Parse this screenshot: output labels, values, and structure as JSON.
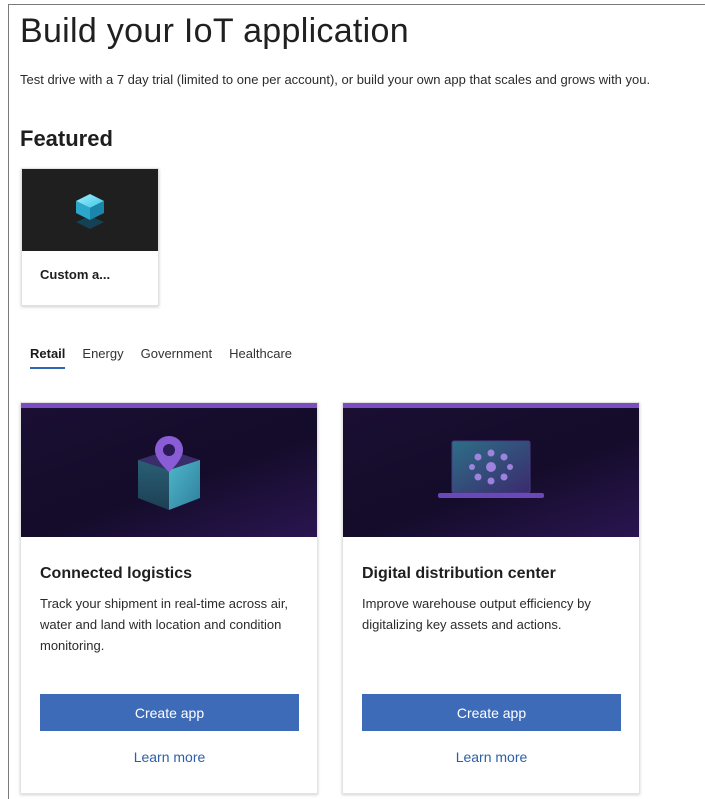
{
  "page": {
    "title": "Build your IoT application",
    "subtitle": "Test drive with a 7 day trial (limited to one per account), or build your own app that scales and grows with you."
  },
  "featured": {
    "heading": "Featured",
    "items": [
      {
        "label": "Custom a...",
        "icon": "iot-cube-icon"
      }
    ]
  },
  "tabs": [
    {
      "label": "Retail",
      "active": true
    },
    {
      "label": "Energy",
      "active": false
    },
    {
      "label": "Government",
      "active": false
    },
    {
      "label": "Healthcare",
      "active": false
    }
  ],
  "templates": [
    {
      "title": "Connected logistics",
      "description": "Track your shipment in real-time across air, water and land with location and condition monitoring.",
      "icon": "package-location-icon",
      "create_label": "Create app",
      "learn_label": "Learn more"
    },
    {
      "title": "Digital distribution center",
      "description": "Improve warehouse output efficiency by digitalizing key assets and actions.",
      "icon": "laptop-network-icon",
      "create_label": "Create app",
      "learn_label": "Learn more"
    }
  ],
  "colors": {
    "accent": "#3e6bb8",
    "link": "#2d5fa8",
    "card_top_border": "#7a4ec0",
    "hero_background": "#140c2a"
  }
}
